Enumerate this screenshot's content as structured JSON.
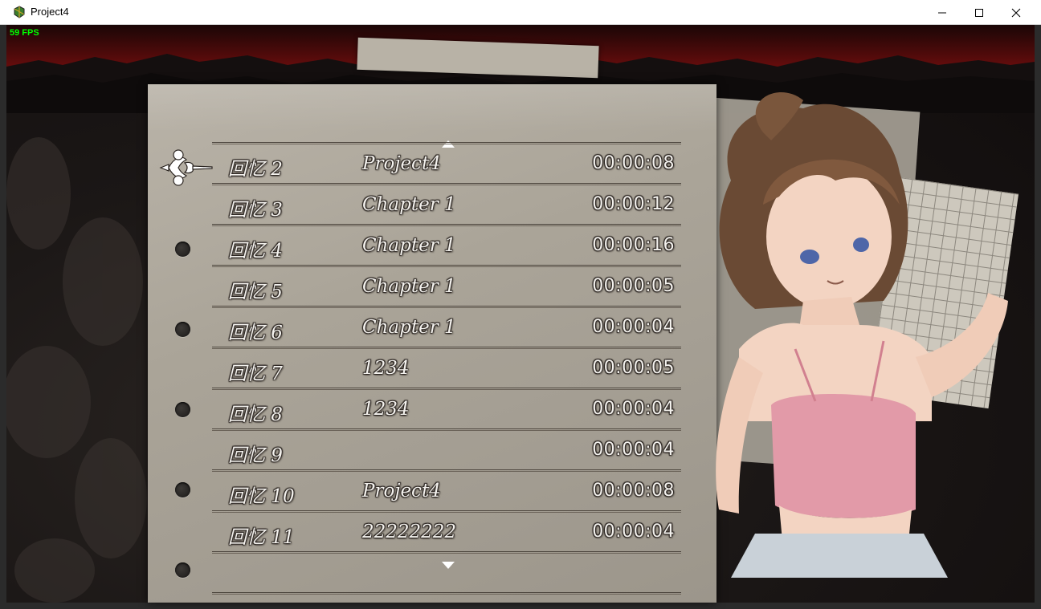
{
  "window": {
    "title": "Project4",
    "icon": "game-app-icon",
    "controls": [
      "minimize-icon",
      "maximize-icon",
      "close-icon"
    ]
  },
  "hud": {
    "fps": "59 FPS",
    "fps_color": "#00ff00"
  },
  "memory_list": {
    "scroll_up_icon": "triangle-up-icon",
    "scroll_down_icon": "triangle-down-icon",
    "cursor_icon": "ornamental-flourish-icon",
    "selected_index": 0,
    "items": [
      {
        "name": "回忆 2",
        "chapter": "Project4",
        "time": "00:00:08"
      },
      {
        "name": "回忆 3",
        "chapter": "Chapter 1",
        "time": "00:00:12"
      },
      {
        "name": "回忆 4",
        "chapter": "Chapter 1",
        "time": "00:00:16"
      },
      {
        "name": "回忆 5",
        "chapter": "Chapter 1",
        "time": "00:00:05"
      },
      {
        "name": "回忆 6",
        "chapter": "Chapter 1",
        "time": "00:00:04"
      },
      {
        "name": "回忆 7",
        "chapter": "1234",
        "time": "00:00:05"
      },
      {
        "name": "回忆 8",
        "chapter": "1234",
        "time": "00:00:04"
      },
      {
        "name": "回忆 9",
        "chapter": "",
        "time": "00:00:04"
      },
      {
        "name": "回忆 10",
        "chapter": "Project4",
        "time": "00:00:08"
      },
      {
        "name": "回忆 11",
        "chapter": "22222222",
        "time": "00:00:04"
      }
    ]
  },
  "colors": {
    "paper": "#aaa498",
    "text": "#f4f2ee",
    "sky_red": "#6b0d0d"
  }
}
